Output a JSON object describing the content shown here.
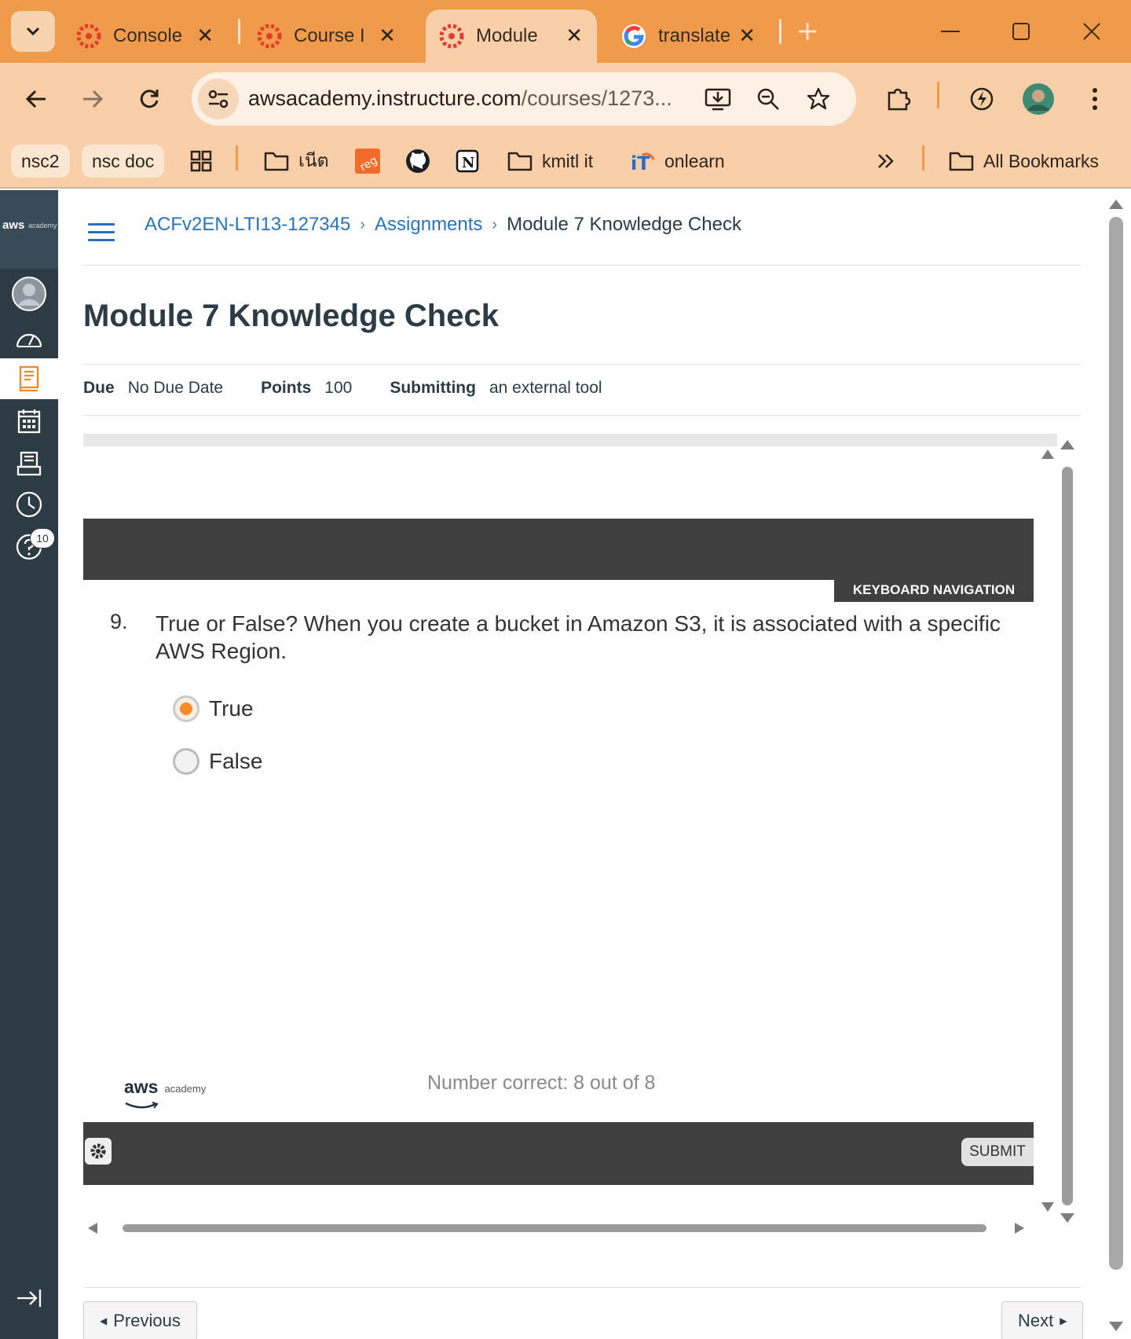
{
  "browser": {
    "tabs": [
      {
        "title": "Console",
        "icon": "canvas-icon"
      },
      {
        "title": "Course I",
        "icon": "canvas-icon"
      },
      {
        "title": "Module",
        "icon": "canvas-icon",
        "active": true
      },
      {
        "title": "translate",
        "icon": "google-icon"
      }
    ],
    "url_host": "awsacademy.instructure.com",
    "url_path": "/courses/1273...",
    "bookmarks": {
      "nsc2": "nsc2",
      "nsc_doc": "nsc doc",
      "neet": "เนีต",
      "kmitl_it": "kmitl it",
      "onlearn": "onlearn",
      "all": "All Bookmarks"
    }
  },
  "nav": {
    "logo_aws": "aws",
    "logo_academy": "academy",
    "help_badge": "10"
  },
  "breadcrumb": {
    "course": "ACFv2EN-LTI13-127345",
    "section": "Assignments",
    "current": "Module 7 Knowledge Check"
  },
  "assignment": {
    "title": "Module 7 Knowledge Check",
    "due_label": "Due",
    "due_value": "No Due Date",
    "points_label": "Points",
    "points_value": "100",
    "submitting_label": "Submitting",
    "submitting_value": "an external tool"
  },
  "quiz": {
    "keyboard_nav": "KEYBOARD NAVIGATION",
    "question_number": "9.",
    "question_text": "True or False? When you create a bucket in Amazon S3, it is associated with a specific AWS Region.",
    "options": [
      {
        "label": "True",
        "selected": true
      },
      {
        "label": "False",
        "selected": false
      }
    ],
    "footer_aws": "aws",
    "footer_academy": "academy",
    "score": "Number correct: 8 out of 8",
    "submit": "SUBMIT",
    "accent_color": "#ff8a2c"
  },
  "pager": {
    "previous": "Previous",
    "next": "Next"
  }
}
